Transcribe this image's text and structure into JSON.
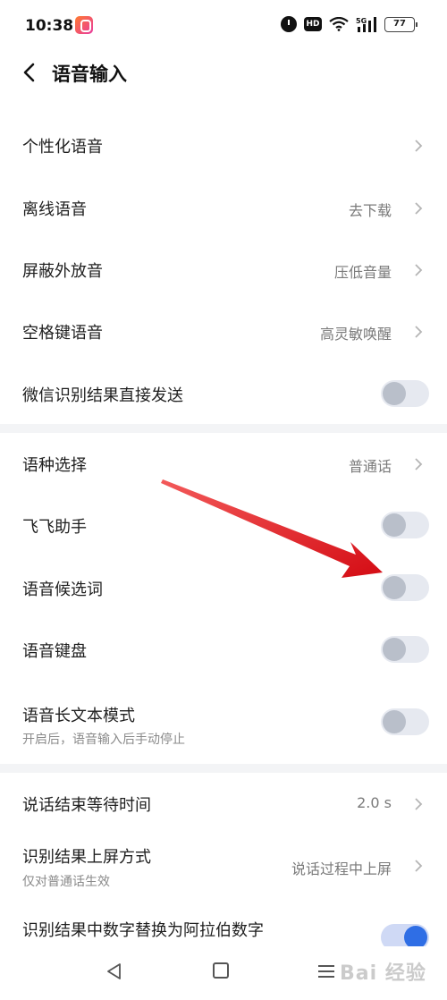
{
  "status_bar": {
    "time": "10:38",
    "battery": "77",
    "hd": "HD"
  },
  "header": {
    "title": "语音输入"
  },
  "rows": [
    {
      "label": "个性化语音",
      "value": "",
      "type": "chevron"
    },
    {
      "label": "离线语音",
      "value": "去下载",
      "type": "chevron"
    },
    {
      "label": "屏蔽外放音",
      "value": "压低音量",
      "type": "chevron"
    },
    {
      "label": "空格键语音",
      "value": "高灵敏唤醒",
      "type": "chevron"
    },
    {
      "label": "微信识别结果直接发送",
      "type": "toggle",
      "on": false
    },
    {
      "label": "语种选择",
      "value": "普通话",
      "type": "chevron"
    },
    {
      "label": "飞飞助手",
      "type": "toggle",
      "on": false
    },
    {
      "label": "语音候选词",
      "type": "toggle",
      "on": false
    },
    {
      "label": "语音键盘",
      "type": "toggle",
      "on": false
    },
    {
      "label": "语音长文本模式",
      "subtitle": "开启后，语音输入后手动停止",
      "type": "toggle",
      "on": false
    },
    {
      "label": "说话结束等待时间",
      "value": "2.0 s",
      "type": "chevron"
    },
    {
      "label": "识别结果上屏方式",
      "subtitle": "仅对普通话生效",
      "value": "说话过程中上屏",
      "type": "chevron"
    },
    {
      "label": "识别结果中数字替换为阿拉伯数字",
      "type": "toggle",
      "on": true
    }
  ],
  "watermark": "Bai 经验",
  "colors": {
    "accent": "#2f6ee5",
    "arrow": "#e8121b",
    "divider": "#f3f4f6"
  }
}
